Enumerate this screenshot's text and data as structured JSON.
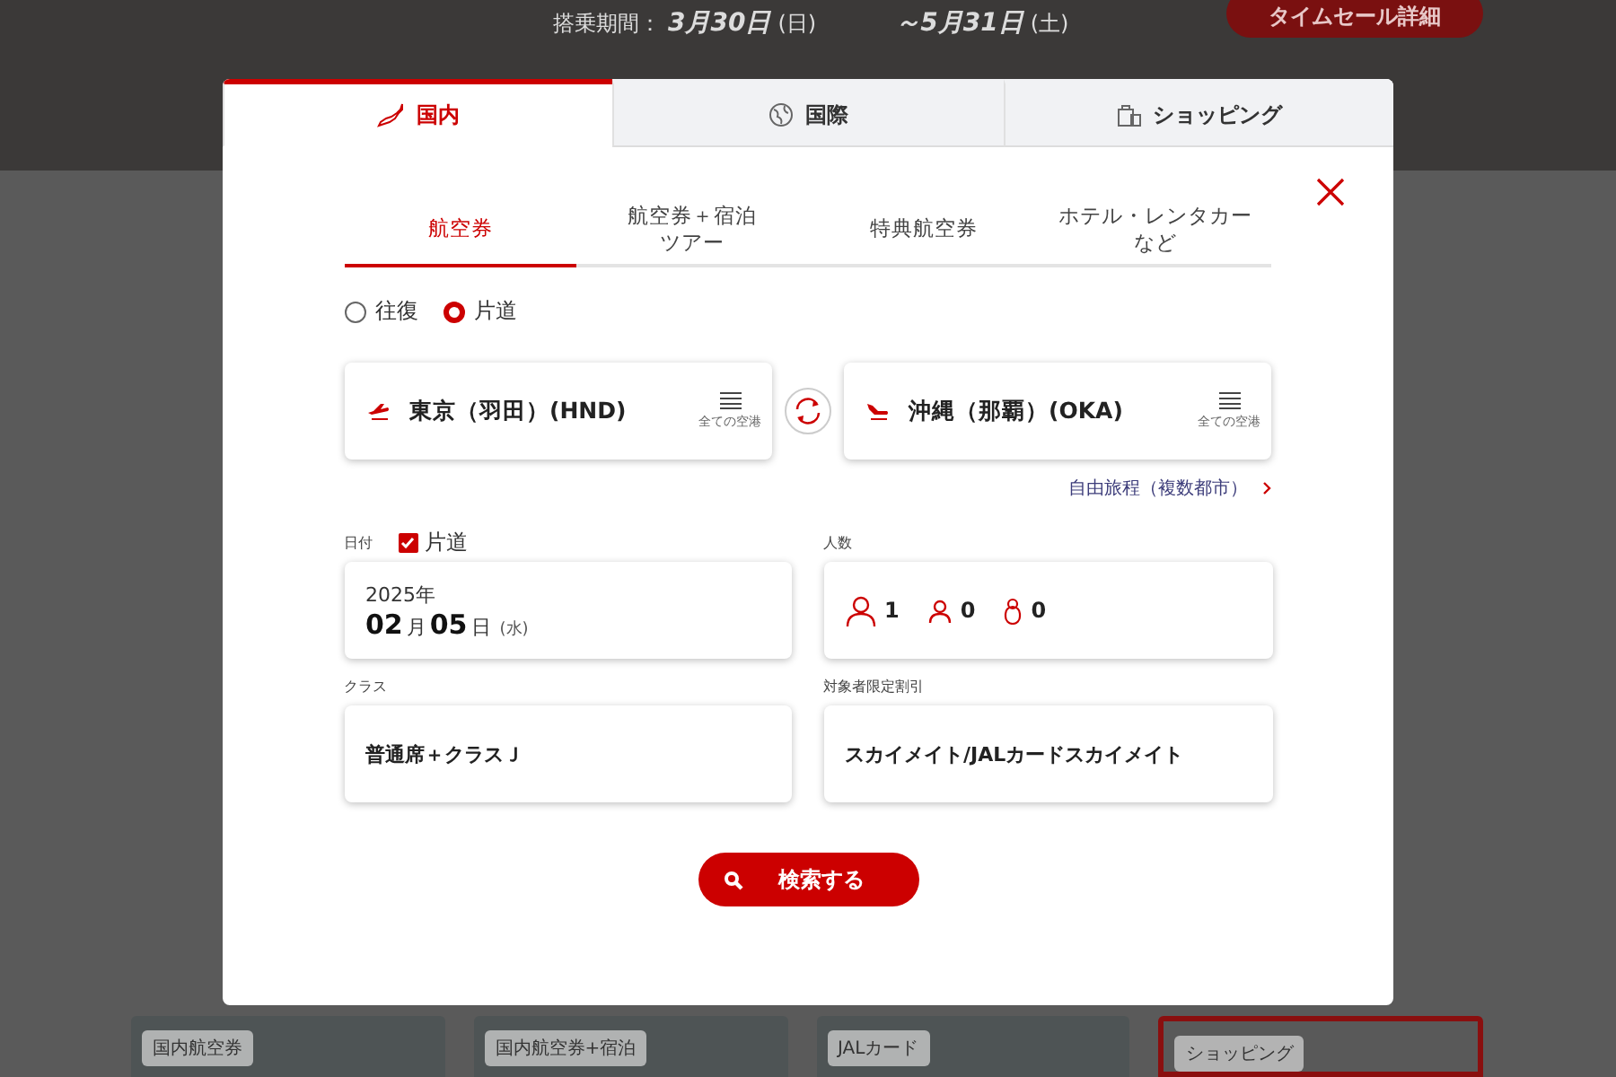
{
  "banner": {
    "period_label": "搭乗期間：",
    "period_start": "3月30日",
    "period_start_day": "(日)",
    "period_end": "～5月31日",
    "period_end_day": "(土)",
    "detail_button": "タイムセール詳細"
  },
  "cards": [
    {
      "label": "国内航空券",
      "kind": "photo"
    },
    {
      "label": "国内航空券+宿泊",
      "kind": "photo"
    },
    {
      "label": "JALカード",
      "kind": "photo"
    },
    {
      "label": "ショッピング",
      "kind": "outlined"
    }
  ],
  "modal": {
    "tabs": [
      {
        "label": "国内",
        "kind": "map",
        "selected": true
      },
      {
        "label": "国際",
        "kind": "globe",
        "selected": false
      },
      {
        "label": "ショッピング",
        "kind": "bag",
        "selected": false
      }
    ],
    "subtabs": [
      {
        "lines": [
          "航空券"
        ],
        "selected": true
      },
      {
        "lines": [
          "航空券＋宿泊",
          "ツアー"
        ],
        "selected": false
      },
      {
        "lines": [
          "特典航空券"
        ],
        "selected": false
      },
      {
        "lines": [
          "ホテル・レンタカー",
          "など"
        ],
        "selected": false
      }
    ],
    "trip_types": [
      {
        "label": "往復",
        "selected": false
      },
      {
        "label": "片道",
        "selected": true
      }
    ],
    "from": {
      "airport": "東京（羽田）(HND)",
      "list_label": "全ての空港"
    },
    "to": {
      "airport": "沖縄（那覇）(OKA)",
      "list_label": "全ての空港"
    },
    "multi_city_link": "自由旅程（複数都市）",
    "date": {
      "label": "日付",
      "one_way_label": "片道",
      "one_way_checked": true,
      "year": "2025年",
      "month": "02",
      "month_unit": "月",
      "day": "05",
      "day_unit": "日",
      "weekday": "(水)"
    },
    "passengers": {
      "label": "人数",
      "items": [
        {
          "kind": "adult",
          "count": "1"
        },
        {
          "kind": "child",
          "count": "0"
        },
        {
          "kind": "infant",
          "count": "0"
        }
      ]
    },
    "class": {
      "label": "クラス",
      "value": "普通席＋クラスＪ"
    },
    "discount": {
      "label": "対象者限定割引",
      "value": "スカイメイト/JALカードスカイメイト"
    },
    "search_button": "検索する"
  }
}
